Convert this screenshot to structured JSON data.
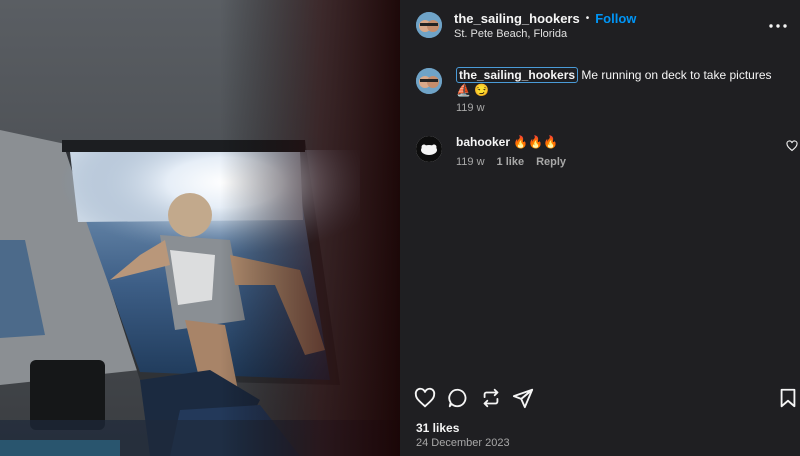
{
  "post": {
    "author": "the_sailing_hookers",
    "separator": "•",
    "follow_label": "Follow",
    "location": "St. Pete Beach, Florida",
    "more_icon": "more-options-icon"
  },
  "caption": {
    "author": "the_sailing_hookers",
    "text": "Me running on deck to take pictures ⛵ 😏",
    "age": "119 w"
  },
  "comments": [
    {
      "author": "bahooker",
      "text": "🔥🔥🔥",
      "age": "119 w",
      "likes": "1 like",
      "reply_label": "Reply"
    }
  ],
  "actions": {
    "icons": [
      "heart-icon",
      "comment-icon",
      "repost-icon",
      "share-icon",
      "bookmark-icon"
    ]
  },
  "stats": {
    "likes": "31 likes",
    "date": "24 December 2023"
  },
  "colors": {
    "background": "#1f1f22",
    "accent": "#0095f6",
    "muted": "#a8a8a8"
  }
}
